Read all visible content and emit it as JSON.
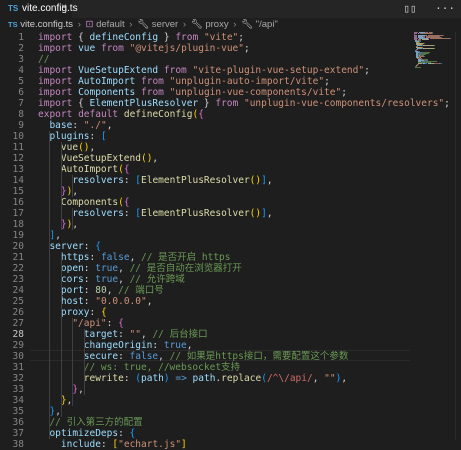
{
  "tab": {
    "lang": "TS",
    "name": "vite.config.ts",
    "close": "×"
  },
  "toolbar": {
    "split": "▯▯",
    "more": "···"
  },
  "breadcrumb": {
    "file": "vite.config.ts",
    "items": [
      "default",
      "server",
      "proxy",
      "\"/api\""
    ]
  },
  "editor": {
    "start_line": 1,
    "active_line": 28,
    "lines": [
      [
        [
          "k",
          "import"
        ],
        [
          "w",
          " { "
        ],
        [
          "v",
          "defineConfig"
        ],
        [
          "w",
          " } "
        ],
        [
          "k",
          "from"
        ],
        [
          "w",
          " "
        ],
        [
          "s",
          "\"vite\""
        ],
        [
          "w",
          ";"
        ]
      ],
      [
        [
          "k",
          "import"
        ],
        [
          "w",
          " "
        ],
        [
          "v",
          "vue"
        ],
        [
          "w",
          " "
        ],
        [
          "k",
          "from"
        ],
        [
          "w",
          " "
        ],
        [
          "s",
          "\"@vitejs/plugin-vue\""
        ],
        [
          "w",
          ";"
        ]
      ],
      [
        [
          "c",
          "//"
        ]
      ],
      [
        [
          "k",
          "import"
        ],
        [
          "w",
          " "
        ],
        [
          "v",
          "VueSetupExtend"
        ],
        [
          "w",
          " "
        ],
        [
          "k",
          "from"
        ],
        [
          "w",
          " "
        ],
        [
          "s",
          "\"vite-plugin-vue-setup-extend\""
        ],
        [
          "w",
          ";"
        ]
      ],
      [
        [
          "k",
          "import"
        ],
        [
          "w",
          " "
        ],
        [
          "v",
          "AutoImport"
        ],
        [
          "w",
          " "
        ],
        [
          "k",
          "from"
        ],
        [
          "w",
          " "
        ],
        [
          "s",
          "\"unplugin-auto-import/vite\""
        ],
        [
          "w",
          ";"
        ]
      ],
      [
        [
          "k",
          "import"
        ],
        [
          "w",
          " "
        ],
        [
          "v",
          "Components"
        ],
        [
          "w",
          " "
        ],
        [
          "k",
          "from"
        ],
        [
          "w",
          " "
        ],
        [
          "s",
          "\"unplugin-vue-components/vite\""
        ],
        [
          "w",
          ";"
        ]
      ],
      [
        [
          "k",
          "import"
        ],
        [
          "w",
          " { "
        ],
        [
          "v",
          "ElementPlusResolver"
        ],
        [
          "w",
          " } "
        ],
        [
          "k",
          "from"
        ],
        [
          "w",
          " "
        ],
        [
          "s",
          "\"unplugin-vue-components/resolvers\""
        ],
        [
          "w",
          ";"
        ]
      ],
      [
        [
          "k",
          "export"
        ],
        [
          "w",
          " "
        ],
        [
          "k",
          "default"
        ],
        [
          "w",
          " "
        ],
        [
          "f",
          "defineConfig"
        ],
        [
          "y",
          "("
        ],
        [
          "p",
          "{"
        ]
      ],
      [
        [
          "w",
          "  "
        ],
        [
          "v",
          "base"
        ],
        [
          "w",
          ": "
        ],
        [
          "s",
          "\"./\""
        ],
        [
          "w",
          ","
        ]
      ],
      [
        [
          "w",
          "  "
        ],
        [
          "v",
          "plugins"
        ],
        [
          "w",
          ": "
        ],
        [
          "q",
          "["
        ]
      ],
      [
        [
          "w",
          "    "
        ],
        [
          "f",
          "vue"
        ],
        [
          "y",
          "()"
        ],
        [
          "w",
          ","
        ]
      ],
      [
        [
          "w",
          "    "
        ],
        [
          "f",
          "VueSetupExtend"
        ],
        [
          "y",
          "()"
        ],
        [
          "w",
          ","
        ]
      ],
      [
        [
          "w",
          "    "
        ],
        [
          "f",
          "AutoImport"
        ],
        [
          "y",
          "("
        ],
        [
          "p",
          "{"
        ]
      ],
      [
        [
          "w",
          "      "
        ],
        [
          "v",
          "resolvers"
        ],
        [
          "w",
          ": "
        ],
        [
          "q",
          "["
        ],
        [
          "f",
          "ElementPlusResolver"
        ],
        [
          "y",
          "()"
        ],
        [
          "q",
          "]"
        ],
        [
          "w",
          ","
        ]
      ],
      [
        [
          "w",
          "    "
        ],
        [
          "p",
          "}"
        ],
        [
          "y",
          ")"
        ],
        [
          "w",
          ","
        ]
      ],
      [
        [
          "w",
          "    "
        ],
        [
          "f",
          "Components"
        ],
        [
          "y",
          "("
        ],
        [
          "p",
          "{"
        ]
      ],
      [
        [
          "w",
          "      "
        ],
        [
          "v",
          "resolvers"
        ],
        [
          "w",
          ": "
        ],
        [
          "q",
          "["
        ],
        [
          "f",
          "ElementPlusResolver"
        ],
        [
          "y",
          "()"
        ],
        [
          "q",
          "]"
        ],
        [
          "w",
          ","
        ]
      ],
      [
        [
          "w",
          "    "
        ],
        [
          "p",
          "}"
        ],
        [
          "y",
          ")"
        ],
        [
          "w",
          ","
        ]
      ],
      [
        [
          "w",
          "  "
        ],
        [
          "q",
          "]"
        ],
        [
          "w",
          ","
        ]
      ],
      [
        [
          "w",
          "  "
        ],
        [
          "v",
          "server"
        ],
        [
          "w",
          ": "
        ],
        [
          "q",
          "{"
        ]
      ],
      [
        [
          "w",
          "    "
        ],
        [
          "v",
          "https"
        ],
        [
          "w",
          ": "
        ],
        [
          "b",
          "false"
        ],
        [
          "w",
          ", "
        ],
        [
          "c",
          "// 是否开启 https"
        ]
      ],
      [
        [
          "w",
          "    "
        ],
        [
          "v",
          "open"
        ],
        [
          "w",
          ": "
        ],
        [
          "b",
          "true"
        ],
        [
          "w",
          ", "
        ],
        [
          "c",
          "// 是否自动在浏览器打开"
        ]
      ],
      [
        [
          "w",
          "    "
        ],
        [
          "v",
          "cors"
        ],
        [
          "w",
          ": "
        ],
        [
          "b",
          "true"
        ],
        [
          "w",
          ", "
        ],
        [
          "c",
          "// 允许跨域"
        ]
      ],
      [
        [
          "w",
          "    "
        ],
        [
          "v",
          "port"
        ],
        [
          "w",
          ": "
        ],
        [
          "n",
          "80"
        ],
        [
          "w",
          ", "
        ],
        [
          "c",
          "// 端口号"
        ]
      ],
      [
        [
          "w",
          "    "
        ],
        [
          "v",
          "host"
        ],
        [
          "w",
          ": "
        ],
        [
          "s",
          "\"0.0.0.0\""
        ],
        [
          "w",
          ","
        ]
      ],
      [
        [
          "w",
          "    "
        ],
        [
          "v",
          "proxy"
        ],
        [
          "w",
          ": "
        ],
        [
          "y",
          "{"
        ]
      ],
      [
        [
          "w",
          "      "
        ],
        [
          "s",
          "\"/api\""
        ],
        [
          "w",
          ": "
        ],
        [
          "p",
          "{"
        ]
      ],
      [
        [
          "w",
          "        "
        ],
        [
          "v",
          "target"
        ],
        [
          "w",
          ": "
        ],
        [
          "s",
          "\"\""
        ],
        [
          "w",
          ", "
        ],
        [
          "c",
          "// 后台接口"
        ]
      ],
      [
        [
          "w",
          "        "
        ],
        [
          "v",
          "changeOrigin"
        ],
        [
          "w",
          ": "
        ],
        [
          "b",
          "true"
        ],
        [
          "w",
          ","
        ]
      ],
      [
        [
          "w",
          "        "
        ],
        [
          "v",
          "secure"
        ],
        [
          "w",
          ": "
        ],
        [
          "b",
          "false"
        ],
        [
          "w",
          ", "
        ],
        [
          "c",
          "// 如果是https接口，需要配置这个参数"
        ]
      ],
      [
        [
          "w",
          "        "
        ],
        [
          "c",
          "// ws: true, //websocket支持"
        ]
      ],
      [
        [
          "w",
          "        "
        ],
        [
          "f",
          "rewrite"
        ],
        [
          "w",
          ": "
        ],
        [
          "q",
          "("
        ],
        [
          "v",
          "path"
        ],
        [
          "q",
          ")"
        ],
        [
          "w",
          " "
        ],
        [
          "b",
          "=>"
        ],
        [
          "w",
          " "
        ],
        [
          "v",
          "path"
        ],
        [
          "w",
          "."
        ],
        [
          "f",
          "replace"
        ],
        [
          "q",
          "("
        ],
        [
          "r",
          "/^\\/api/"
        ],
        [
          "w",
          ", "
        ],
        [
          "s",
          "\"\""
        ],
        [
          "q",
          ")"
        ],
        [
          "w",
          ","
        ]
      ],
      [
        [
          "w",
          "      "
        ],
        [
          "p",
          "}"
        ],
        [
          "w",
          ","
        ]
      ],
      [
        [
          "w",
          "    "
        ],
        [
          "y",
          "}"
        ],
        [
          "w",
          ","
        ]
      ],
      [
        [
          "w",
          "  "
        ],
        [
          "q",
          "}"
        ],
        [
          "w",
          ","
        ]
      ],
      [
        [
          "w",
          "  "
        ],
        [
          "c",
          "// 引入第三方的配置"
        ]
      ],
      [
        [
          "w",
          "  "
        ],
        [
          "v",
          "optimizeDeps"
        ],
        [
          "w",
          ": "
        ],
        [
          "q",
          "{"
        ]
      ],
      [
        [
          "w",
          "    "
        ],
        [
          "v",
          "include"
        ],
        [
          "w",
          ": "
        ],
        [
          "y",
          "["
        ],
        [
          "s",
          "\"echart.js\""
        ],
        [
          "y",
          "]"
        ]
      ]
    ]
  },
  "colors": {
    "background": "#1e1e1e",
    "keyword": "#c586c0",
    "string": "#ce9178",
    "comment": "#6a9955",
    "function": "#dcdcaa",
    "variable": "#9cdcfe",
    "boolean": "#569cd6",
    "number": "#b5cea8"
  }
}
